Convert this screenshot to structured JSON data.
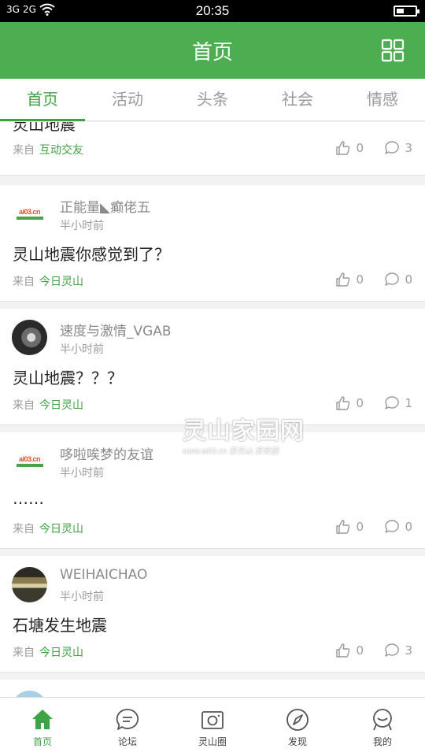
{
  "status_bar": {
    "signal_1": "3G",
    "signal_2": "2G",
    "time": "20:35"
  },
  "header": {
    "title": "首页",
    "grid_icon": "grid-icon"
  },
  "tabs": [
    {
      "label": "首页",
      "active": true
    },
    {
      "label": "活动",
      "active": false
    },
    {
      "label": "头条",
      "active": false
    },
    {
      "label": "社会",
      "active": false
    },
    {
      "label": "情感",
      "active": false
    }
  ],
  "posts": [
    {
      "content": "灵山地震",
      "source_prefix": "来自",
      "source_name": "互动交友",
      "likes": "0",
      "comments": "3"
    },
    {
      "username": "正能量◣癫佬五",
      "time": "半小时前",
      "content": "灵山地震你感觉到了？",
      "source_prefix": "来自",
      "source_name": "今日灵山",
      "likes": "0",
      "comments": "0",
      "avatar_text": "ai03.cn"
    },
    {
      "username": "速度与激情_VGAB",
      "time": "半小时前",
      "content": "灵山地震？？？",
      "source_prefix": "来自",
      "source_name": "今日灵山",
      "likes": "0",
      "comments": "1"
    },
    {
      "username": "哆啦唉梦的友谊",
      "time": "半小时前",
      "content": "……",
      "source_prefix": "来自",
      "source_name": "今日灵山",
      "likes": "0",
      "comments": "0",
      "avatar_text": "ai03.cn"
    },
    {
      "username": "WEIHAICHAO",
      "time": "半小时前",
      "content": "石塘发生地震",
      "source_prefix": "来自",
      "source_name": "今日灵山",
      "likes": "0",
      "comments": "3"
    }
  ],
  "watermark": {
    "line1": "灵山家园网",
    "line2": "www.ai03.cn 爱灵山 爱家园"
  },
  "bottom_nav": [
    {
      "label": "首页",
      "icon": "home-icon",
      "active": true
    },
    {
      "label": "论坛",
      "icon": "chat-bubble-icon",
      "active": false
    },
    {
      "label": "灵山圈",
      "icon": "camera-icon",
      "active": false
    },
    {
      "label": "发现",
      "icon": "compass-icon",
      "active": false
    },
    {
      "label": "我的",
      "icon": "user-icon",
      "active": false
    }
  ],
  "colors": {
    "brand_green": "#4cae50",
    "accent_green": "#3fa244"
  }
}
